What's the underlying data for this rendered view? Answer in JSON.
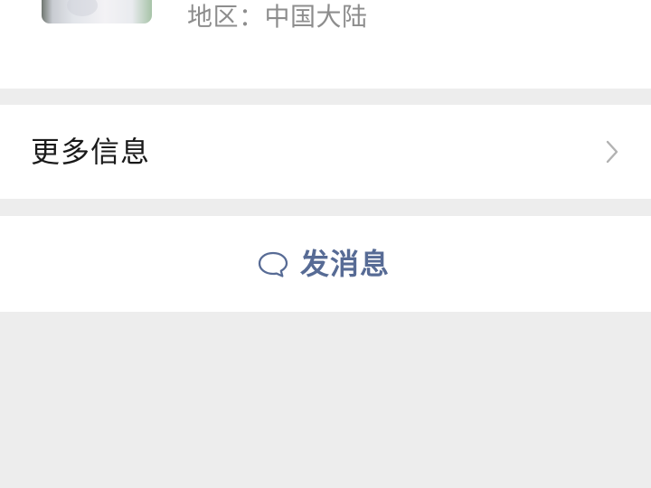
{
  "profile": {
    "region_text": "地区：中国大陆"
  },
  "actions": {
    "more_info_label": "更多信息",
    "send_message_label": "发消息"
  },
  "icons": {
    "avatar": "profile-avatar",
    "more_info": "chevron-right-icon",
    "send_message": "chat-bubble-icon"
  },
  "colors": {
    "background": "#ededed",
    "surface": "#ffffff",
    "primary_text": "#191919",
    "secondary_text": "#8d8d8d",
    "link": "#576b95",
    "chevron": "#b2b2b2"
  }
}
